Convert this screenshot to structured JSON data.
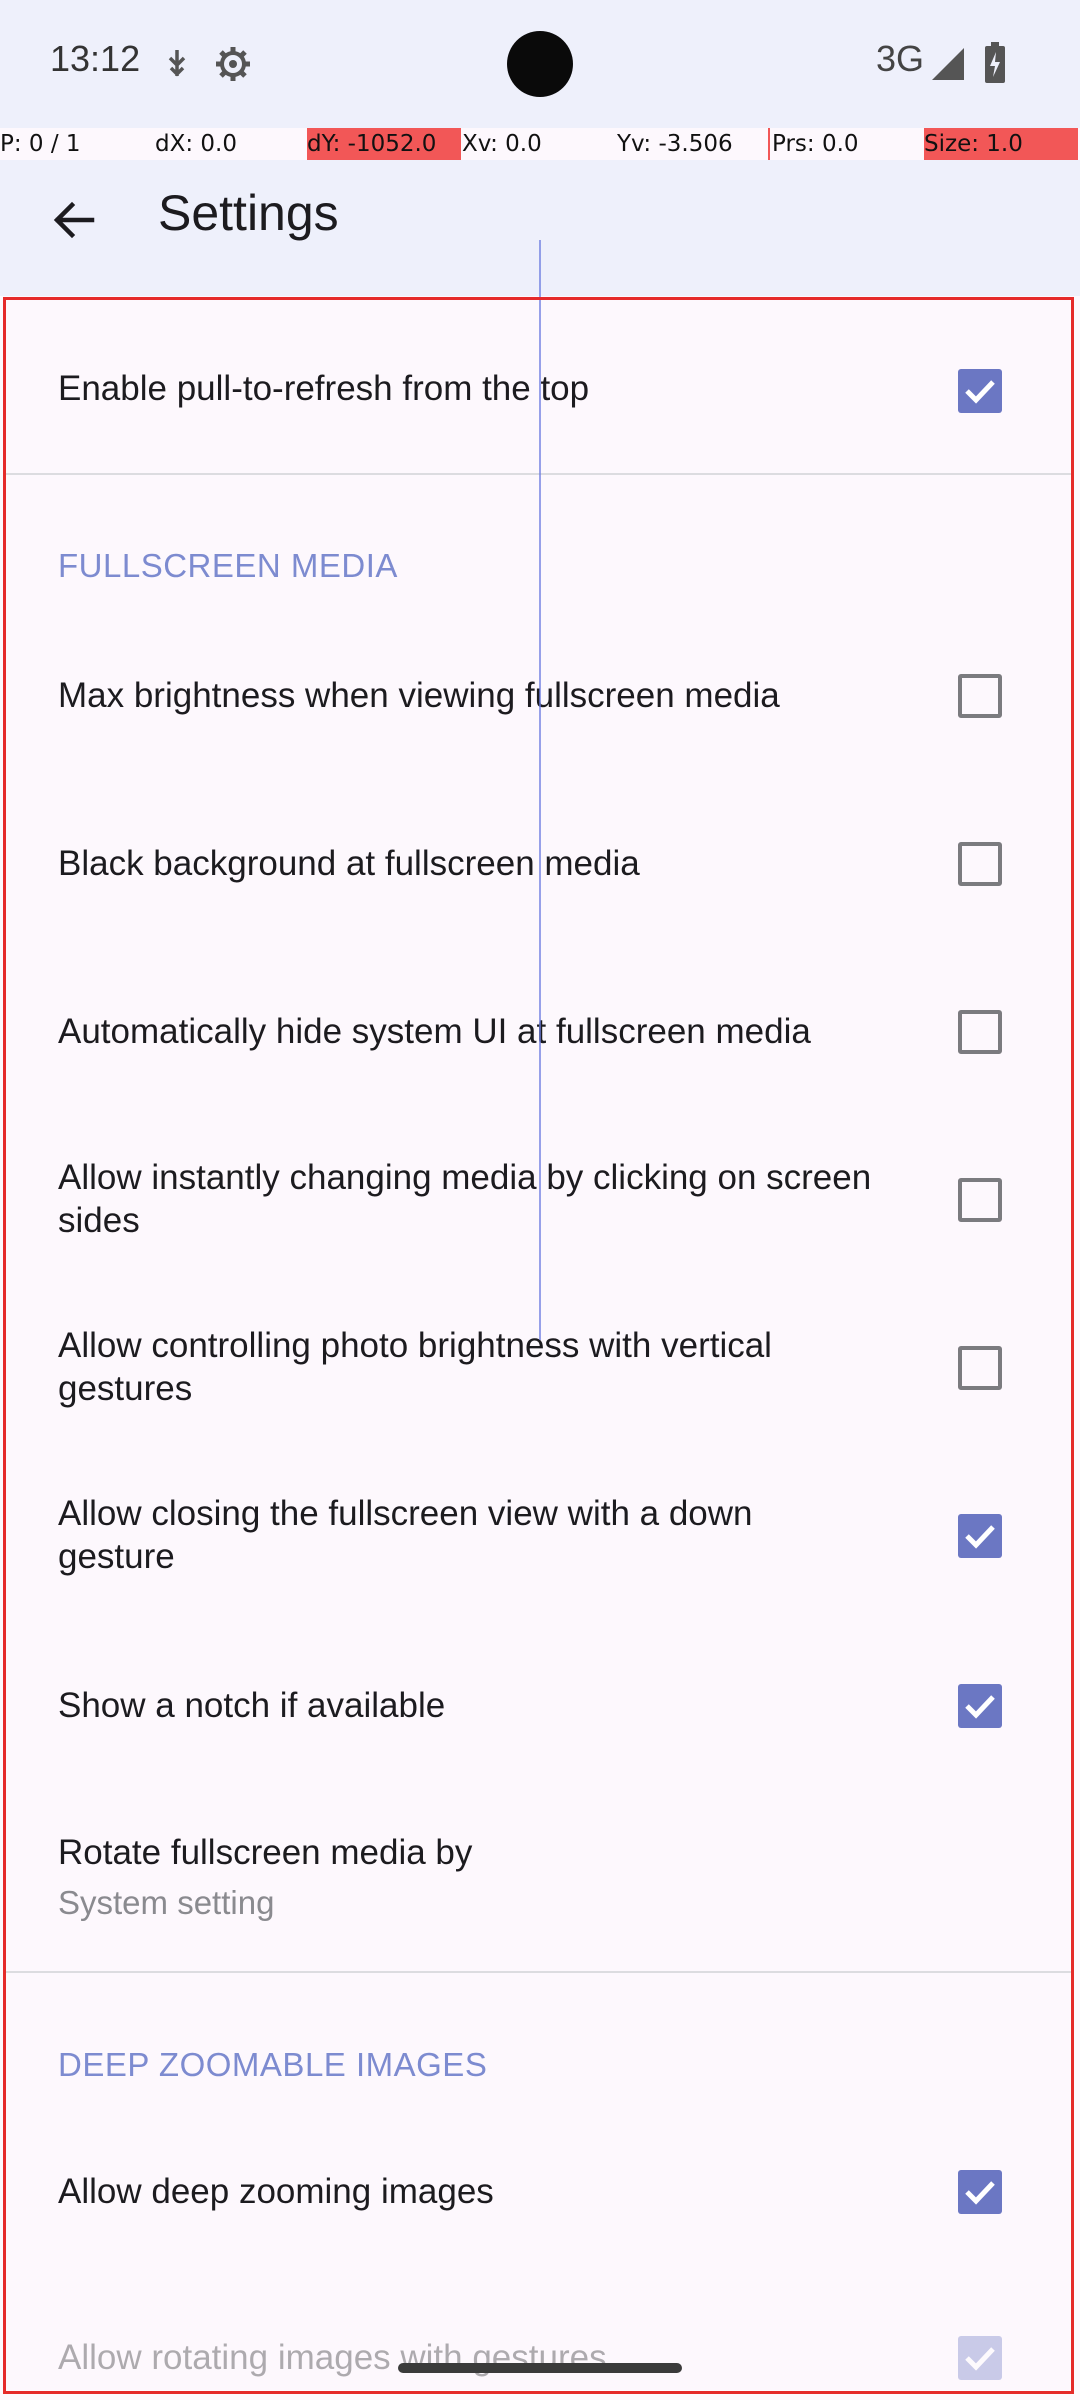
{
  "status_bar": {
    "time": "13:12",
    "network": "3G",
    "icons": [
      "usb-debug-icon",
      "settings-gear-icon",
      "signal-icon",
      "battery-icon"
    ]
  },
  "pointer_overlay": {
    "p": "P: 0 / 1",
    "dx": "dX: 0.0",
    "dy": "dY: -1052.0",
    "xv": "Xv: 0.0",
    "yv": "Yv: -3.506",
    "prs": "Prs: 0.0",
    "size": "Size: 1.0"
  },
  "app_bar": {
    "title": "Settings"
  },
  "settings": {
    "pull_refresh": {
      "label": "Enable pull-to-refresh from the top",
      "checked": true
    },
    "fullscreen_header": "FULLSCREEN MEDIA",
    "max_brightness": {
      "label": "Max brightness when viewing fullscreen media",
      "checked": false
    },
    "black_background": {
      "label": "Black background at fullscreen media",
      "checked": false
    },
    "hide_system_ui": {
      "label": "Automatically hide system UI at fullscreen media",
      "checked": false
    },
    "instant_change": {
      "label": "Allow instantly changing media by clicking on screen sides",
      "checked": false
    },
    "photo_brightness": {
      "label": "Allow controlling photo brightness with vertical gestures",
      "checked": false
    },
    "close_down": {
      "label": "Allow closing the fullscreen view with a down gesture",
      "checked": true
    },
    "show_notch": {
      "label": "Show a notch if available",
      "checked": true
    },
    "rotate": {
      "label": "Rotate fullscreen media by",
      "summary": "System setting"
    },
    "deep_zoom_header": "DEEP ZOOMABLE IMAGES",
    "deep_zoom": {
      "label": "Allow deep zooming images",
      "checked": true
    },
    "rotate_gestures": {
      "label": "Allow rotating images with gestures",
      "checked": true
    }
  },
  "colors": {
    "accent": "#6b77c3",
    "header": "#7d8bd0",
    "highlight": "#e52a2a"
  }
}
